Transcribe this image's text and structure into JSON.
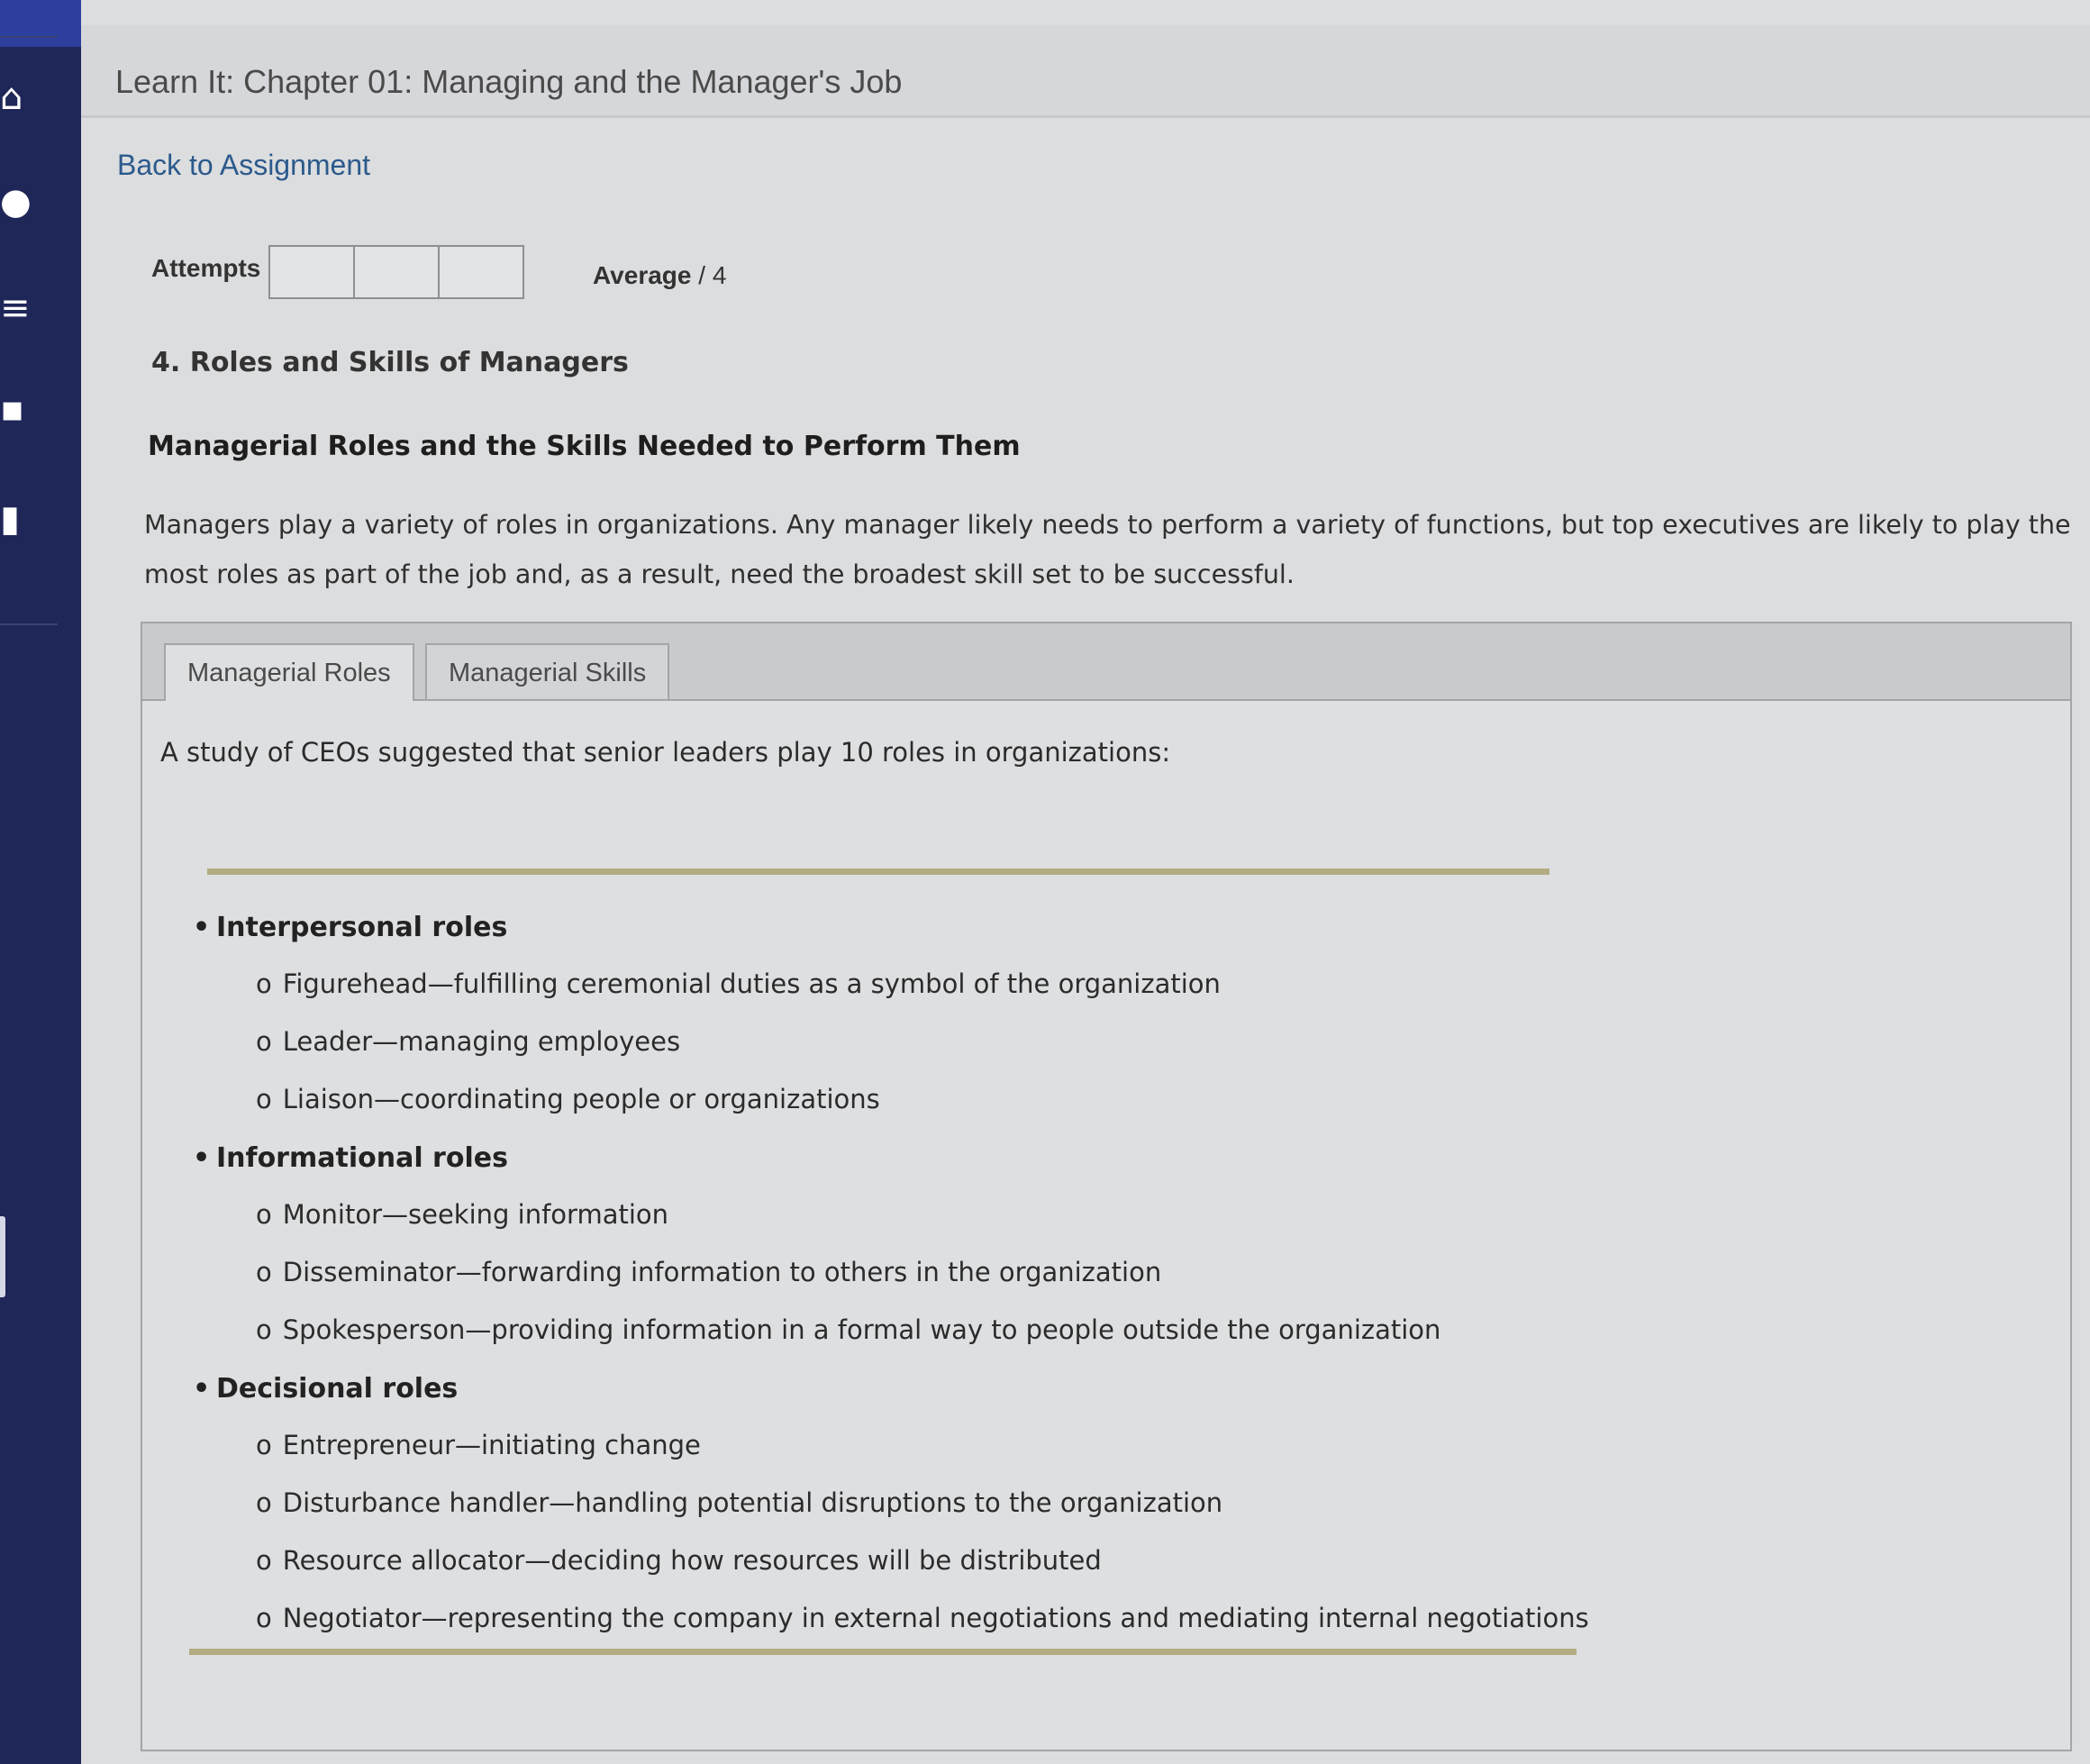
{
  "header": {
    "title": "Learn It: Chapter 01: Managing and the Manager's Job",
    "back_link": "Back to Assignment"
  },
  "score": {
    "attempts_label": "Attempts",
    "average_label": "Average",
    "average_suffix": "/ 4"
  },
  "section": {
    "title": "4. Roles and Skills of Managers",
    "subtitle": "Managerial Roles and the Skills Needed to Perform Them",
    "intro": "Managers play a variety of roles in organizations. Any manager likely needs to perform a variety of functions, but top executives are likely to play the most roles as part of the job and, as a result, need the broadest skill set to be successful."
  },
  "tabs": [
    {
      "label": "Managerial Roles",
      "active": true
    },
    {
      "label": "Managerial Skills",
      "active": false
    }
  ],
  "roles_tab": {
    "lead": "A study of CEOs suggested that senior leaders play 10 roles in organizations:",
    "groups": [
      {
        "title": "Interpersonal roles",
        "items": [
          "Figurehead—fulfilling ceremonial duties as a symbol of the organization",
          "Leader—managing employees",
          "Liaison—coordinating people or organizations"
        ]
      },
      {
        "title": "Informational roles",
        "items": [
          "Monitor—seeking information",
          "Disseminator—forwarding information to others in the organization",
          "Spokesperson—providing information in a formal way to people outside the organization"
        ]
      },
      {
        "title": "Decisional roles",
        "items": [
          "Entrepreneur—initiating change",
          "Disturbance handler—handling potential disruptions to the organization",
          "Resource allocator—deciding how resources will be distributed",
          "Negotiator—representing the company in external negotiations and mediating internal negotiations"
        ]
      }
    ],
    "bullet": "•",
    "sub_marker": "o"
  },
  "colors": {
    "sidebar": "#1f2658",
    "link": "#2c5a8c",
    "rule": "#b3ac82"
  }
}
